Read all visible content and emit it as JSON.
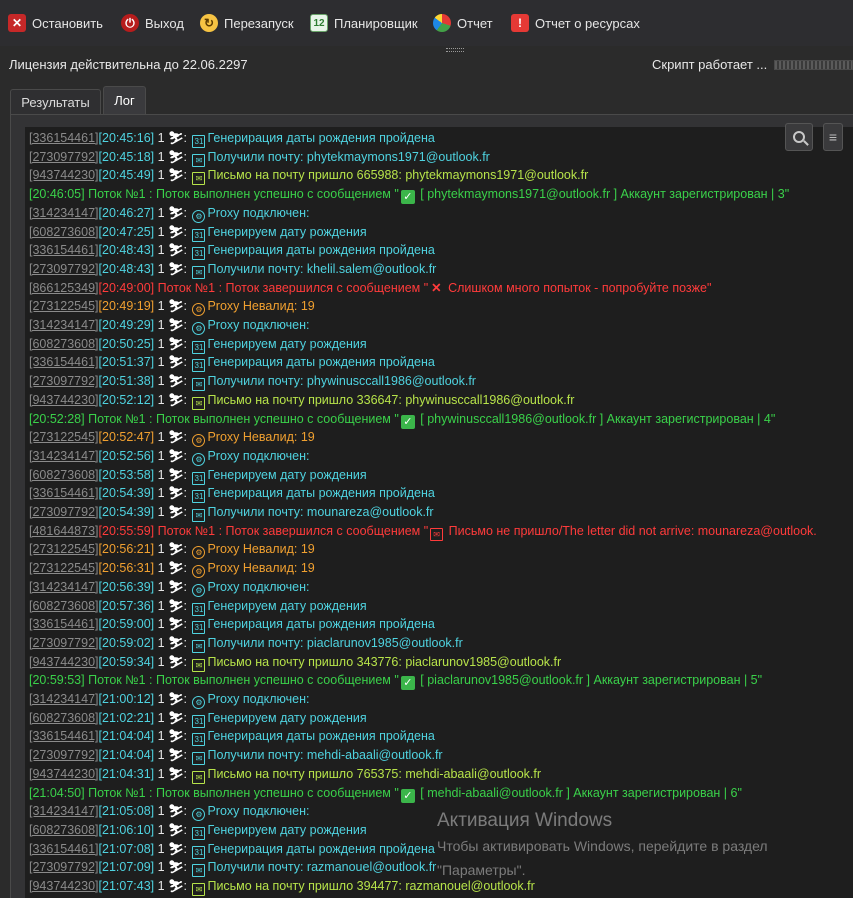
{
  "toolbar": {
    "stop": "Остановить",
    "exit": "Выход",
    "restart": "Перезапуск",
    "scheduler": "Планировщик",
    "scheduler_icon_text": "12",
    "report": "Отчет",
    "resources": "Отчет о ресурсах"
  },
  "status": {
    "license": "Лицензия действительна до 22.06.2297",
    "script": "Скрипт работает ..."
  },
  "tabs": {
    "results": "Результаты",
    "log": "Лог"
  },
  "log": [
    {
      "id": "[336154461]",
      "ts": "[20:45:16]",
      "n": "1",
      "icon": "cal",
      "text": "Генерирация даты рождения пройдена",
      "kind": "cyan"
    },
    {
      "id": "[273097792]",
      "ts": "[20:45:18]",
      "n": "1",
      "icon": "env",
      "text": "Получили почту: phytekmaymons1971@outlook.fr",
      "kind": "cyan"
    },
    {
      "id": "[943744230]",
      "ts": "[20:45:49]",
      "n": "1",
      "icon": "env",
      "text": "Письмо на почту пришло 665988: phytekmaymons1971@outlook.fr",
      "kind": "lime"
    },
    {
      "id": "",
      "ts": "[20:46:05]",
      "n": "",
      "icon": "",
      "text": " Поток №1 : Поток выполнен успешно с сообщением \"",
      "kind": "success",
      "tail": "[ phytekmaymons1971@outlook.fr ] Аккаунт зарегистрирован | 3\""
    },
    {
      "id": "[314234147]",
      "ts": "[20:46:27]",
      "n": "1",
      "icon": "gear",
      "text": "Proxy подключен:",
      "kind": "cyan"
    },
    {
      "id": "[608273608]",
      "ts": "[20:47:25]",
      "n": "1",
      "icon": "cal",
      "text": "Генерируем дату рождения",
      "kind": "cyan"
    },
    {
      "id": "[336154461]",
      "ts": "[20:48:43]",
      "n": "1",
      "icon": "cal",
      "text": "Генерирация даты рождения пройдена",
      "kind": "cyan"
    },
    {
      "id": "[273097792]",
      "ts": "[20:48:43]",
      "n": "1",
      "icon": "env",
      "text": "Получили почту: khelil.salem@outlook.fr",
      "kind": "cyan"
    },
    {
      "id": "[866125349]",
      "ts": "[20:49:00]",
      "n": "",
      "icon": "",
      "text": " Поток №1 : Поток завершился с сообщением \"",
      "kind": "error",
      "tail": "Слишком много попыток - попробуйте позже\"",
      "mark": "x"
    },
    {
      "id": "[273122545]",
      "ts": "[20:49:19]",
      "n": "1",
      "icon": "gear",
      "text": "Proxy Невалид: 19",
      "kind": "orange"
    },
    {
      "id": "[314234147]",
      "ts": "[20:49:29]",
      "n": "1",
      "icon": "gear",
      "text": "Proxy подключен:",
      "kind": "cyan"
    },
    {
      "id": "[608273608]",
      "ts": "[20:50:25]",
      "n": "1",
      "icon": "cal",
      "text": "Генерируем дату рождения",
      "kind": "cyan"
    },
    {
      "id": "[336154461]",
      "ts": "[20:51:37]",
      "n": "1",
      "icon": "cal",
      "text": "Генерирация даты рождения пройдена",
      "kind": "cyan"
    },
    {
      "id": "[273097792]",
      "ts": "[20:51:38]",
      "n": "1",
      "icon": "env",
      "text": "Получили почту: phywinusccall1986@outlook.fr",
      "kind": "cyan"
    },
    {
      "id": "[943744230]",
      "ts": "[20:52:12]",
      "n": "1",
      "icon": "env",
      "text": "Письмо на почту пришло 336647: phywinusccall1986@outlook.fr",
      "kind": "lime"
    },
    {
      "id": "",
      "ts": "[20:52:28]",
      "n": "",
      "icon": "",
      "text": " Поток №1 : Поток выполнен успешно с сообщением \"",
      "kind": "success",
      "tail": "[ phywinusccall1986@outlook.fr ] Аккаунт зарегистрирован | 4\""
    },
    {
      "id": "[273122545]",
      "ts": "[20:52:47]",
      "n": "1",
      "icon": "gear",
      "text": "Proxy Невалид: 19",
      "kind": "orange"
    },
    {
      "id": "[314234147]",
      "ts": "[20:52:56]",
      "n": "1",
      "icon": "gear",
      "text": "Proxy подключен:",
      "kind": "cyan"
    },
    {
      "id": "[608273608]",
      "ts": "[20:53:58]",
      "n": "1",
      "icon": "cal",
      "text": "Генерируем дату рождения",
      "kind": "cyan"
    },
    {
      "id": "[336154461]",
      "ts": "[20:54:39]",
      "n": "1",
      "icon": "cal",
      "text": "Генерирация даты рождения пройдена",
      "kind": "cyan"
    },
    {
      "id": "[273097792]",
      "ts": "[20:54:39]",
      "n": "1",
      "icon": "env",
      "text": "Получили почту: mounareza@outlook.fr",
      "kind": "cyan"
    },
    {
      "id": "[481644873]",
      "ts": "[20:55:59]",
      "n": "",
      "icon": "",
      "text": " Поток №1 : Поток завершился с сообщением \"",
      "kind": "error",
      "tail": "Письмо не пришло/The letter did not arrive: mounareza@outlook.",
      "mark": "env"
    },
    {
      "id": "[273122545]",
      "ts": "[20:56:21]",
      "n": "1",
      "icon": "gear",
      "text": "Proxy Невалид: 19",
      "kind": "orange"
    },
    {
      "id": "[273122545]",
      "ts": "[20:56:31]",
      "n": "1",
      "icon": "gear",
      "text": "Proxy Невалид: 19",
      "kind": "orange"
    },
    {
      "id": "[314234147]",
      "ts": "[20:56:39]",
      "n": "1",
      "icon": "gear",
      "text": "Proxy подключен:",
      "kind": "cyan"
    },
    {
      "id": "[608273608]",
      "ts": "[20:57:36]",
      "n": "1",
      "icon": "cal",
      "text": "Генерируем дату рождения",
      "kind": "cyan"
    },
    {
      "id": "[336154461]",
      "ts": "[20:59:00]",
      "n": "1",
      "icon": "cal",
      "text": "Генерирация даты рождения пройдена",
      "kind": "cyan"
    },
    {
      "id": "[273097792]",
      "ts": "[20:59:02]",
      "n": "1",
      "icon": "env",
      "text": "Получили почту: piaclarunov1985@outlook.fr",
      "kind": "cyan"
    },
    {
      "id": "[943744230]",
      "ts": "[20:59:34]",
      "n": "1",
      "icon": "env",
      "text": "Письмо на почту пришло 343776: piaclarunov1985@outlook.fr",
      "kind": "lime"
    },
    {
      "id": "",
      "ts": "[20:59:53]",
      "n": "",
      "icon": "",
      "text": " Поток №1 : Поток выполнен успешно с сообщением \"",
      "kind": "success",
      "tail": "[ piaclarunov1985@outlook.fr ] Аккаунт зарегистрирован | 5\""
    },
    {
      "id": "[314234147]",
      "ts": "[21:00:12]",
      "n": "1",
      "icon": "gear",
      "text": "Proxy подключен:",
      "kind": "cyan"
    },
    {
      "id": "[608273608]",
      "ts": "[21:02:21]",
      "n": "1",
      "icon": "cal",
      "text": "Генерируем дату рождения",
      "kind": "cyan"
    },
    {
      "id": "[336154461]",
      "ts": "[21:04:04]",
      "n": "1",
      "icon": "cal",
      "text": "Генерирация даты рождения пройдена",
      "kind": "cyan"
    },
    {
      "id": "[273097792]",
      "ts": "[21:04:04]",
      "n": "1",
      "icon": "env",
      "text": "Получили почту: mehdi-abaali@outlook.fr",
      "kind": "cyan"
    },
    {
      "id": "[943744230]",
      "ts": "[21:04:31]",
      "n": "1",
      "icon": "env",
      "text": "Письмо на почту пришло 765375: mehdi-abaali@outlook.fr",
      "kind": "lime"
    },
    {
      "id": "",
      "ts": "[21:04:50]",
      "n": "",
      "icon": "",
      "text": " Поток №1 : Поток выполнен успешно с сообщением \"",
      "kind": "success",
      "tail": "[ mehdi-abaali@outlook.fr ] Аккаунт зарегистрирован | 6\""
    },
    {
      "id": "[314234147]",
      "ts": "[21:05:08]",
      "n": "1",
      "icon": "gear",
      "text": "Proxy подключен:",
      "kind": "cyan"
    },
    {
      "id": "[608273608]",
      "ts": "[21:06:10]",
      "n": "1",
      "icon": "cal",
      "text": "Генерируем дату рождения",
      "kind": "cyan"
    },
    {
      "id": "[336154461]",
      "ts": "[21:07:08]",
      "n": "1",
      "icon": "cal",
      "text": "Генерирация даты рождения пройдена",
      "kind": "cyan"
    },
    {
      "id": "[273097792]",
      "ts": "[21:07:09]",
      "n": "1",
      "icon": "env",
      "text": "Получили почту: razmanouel@outlook.fr",
      "kind": "cyan"
    },
    {
      "id": "[943744230]",
      "ts": "[21:07:43]",
      "n": "1",
      "icon": "env",
      "text": "Письмо на почту пришло 394477: razmanouel@outlook.fr",
      "kind": "lime"
    }
  ],
  "watermark": {
    "title": "Активация Windows",
    "line1": "Чтобы активировать Windows, перейдите в раздел",
    "line2": "\"Параметры\"."
  },
  "colors": {
    "cyan": "#4fd3e0",
    "green": "#3ad14a",
    "lime": "#b7e34a",
    "orange": "#f0a030",
    "red": "#ff3b3b",
    "background": "#1e1e1e"
  },
  "icons": {
    "stop": "close-square-icon",
    "exit": "power-icon",
    "restart": "restart-icon",
    "scheduler": "calendar-icon",
    "report": "pie-chart-icon",
    "resources": "resource-report-icon",
    "search": "search-icon",
    "menu": "menu-icon"
  }
}
